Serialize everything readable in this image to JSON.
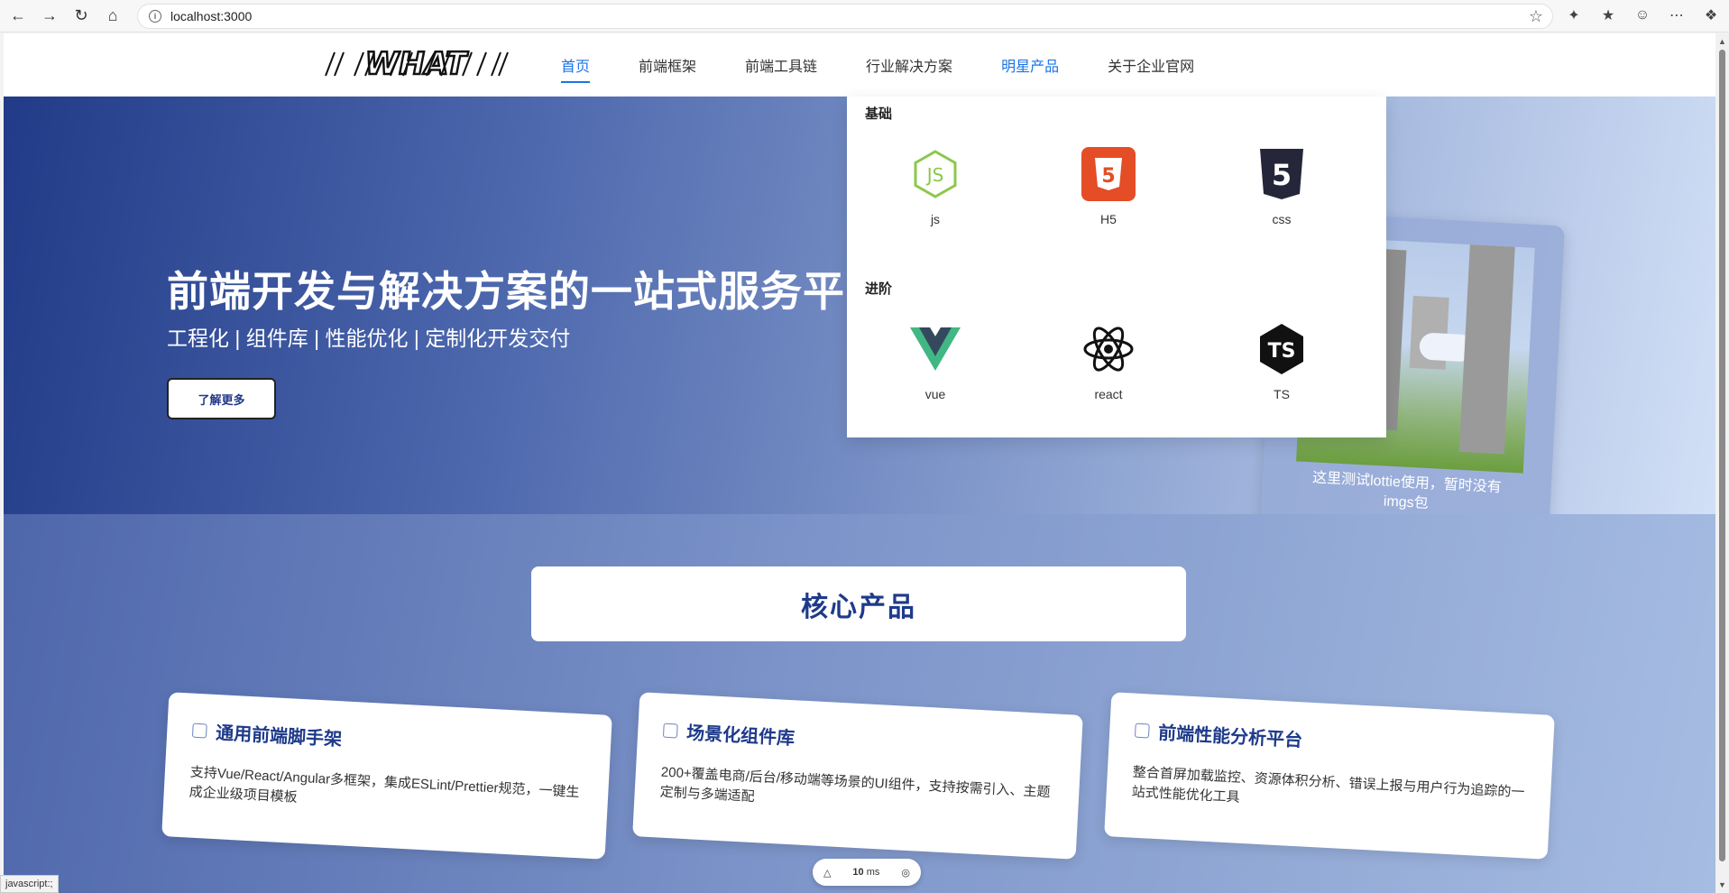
{
  "browser": {
    "url": "localhost:3000",
    "status_text": "javascript:;"
  },
  "header": {
    "logo_text": "WHAT",
    "menu": [
      {
        "label": "首页",
        "active": true
      },
      {
        "label": "前端框架",
        "active": false
      },
      {
        "label": "前端工具链",
        "active": false
      },
      {
        "label": "行业解决方案",
        "active": false
      },
      {
        "label": "明星产品",
        "active": false
      },
      {
        "label": "关于企业官网",
        "active": false
      }
    ]
  },
  "hero": {
    "title": "前端开发与解决方案的一站式服务平",
    "subtitle": "工程化 | 组件库 | 性能优化 | 定制化开发交付",
    "button_label": "了解更多",
    "lottie_caption": "这里测试lottie使用，暂时没有imgs包"
  },
  "dropdown": {
    "groups": [
      {
        "title": "基础",
        "items": [
          {
            "label": "js",
            "icon": "nodejs-icon"
          },
          {
            "label": "H5",
            "icon": "html5-icon"
          },
          {
            "label": "css",
            "icon": "css3-icon"
          }
        ]
      },
      {
        "title": "进阶",
        "items": [
          {
            "label": "vue",
            "icon": "vue-icon"
          },
          {
            "label": "react",
            "icon": "react-icon"
          },
          {
            "label": "TS",
            "icon": "typescript-icon"
          }
        ]
      }
    ]
  },
  "core": {
    "title": "核心产品",
    "cards": [
      {
        "title": "通用前端脚手架",
        "desc": "支持Vue/React/Angular多框架，集成ESLint/Prettier规范，一键生成企业级项目模板"
      },
      {
        "title": "场景化组件库",
        "desc": "200+覆盖电商/后台/移动端等场景的UI组件，支持按需引入、主题定制与多端适配"
      },
      {
        "title": "前端性能分析平台",
        "desc": "整合首屏加载监控、资源体积分析、错误上报与用户行为追踪的一站式性能优化工具"
      }
    ]
  },
  "perf_widget": {
    "value": "10",
    "unit": "ms"
  },
  "colors": {
    "accent": "#1a73e8",
    "brand": "#1e3a8a"
  }
}
